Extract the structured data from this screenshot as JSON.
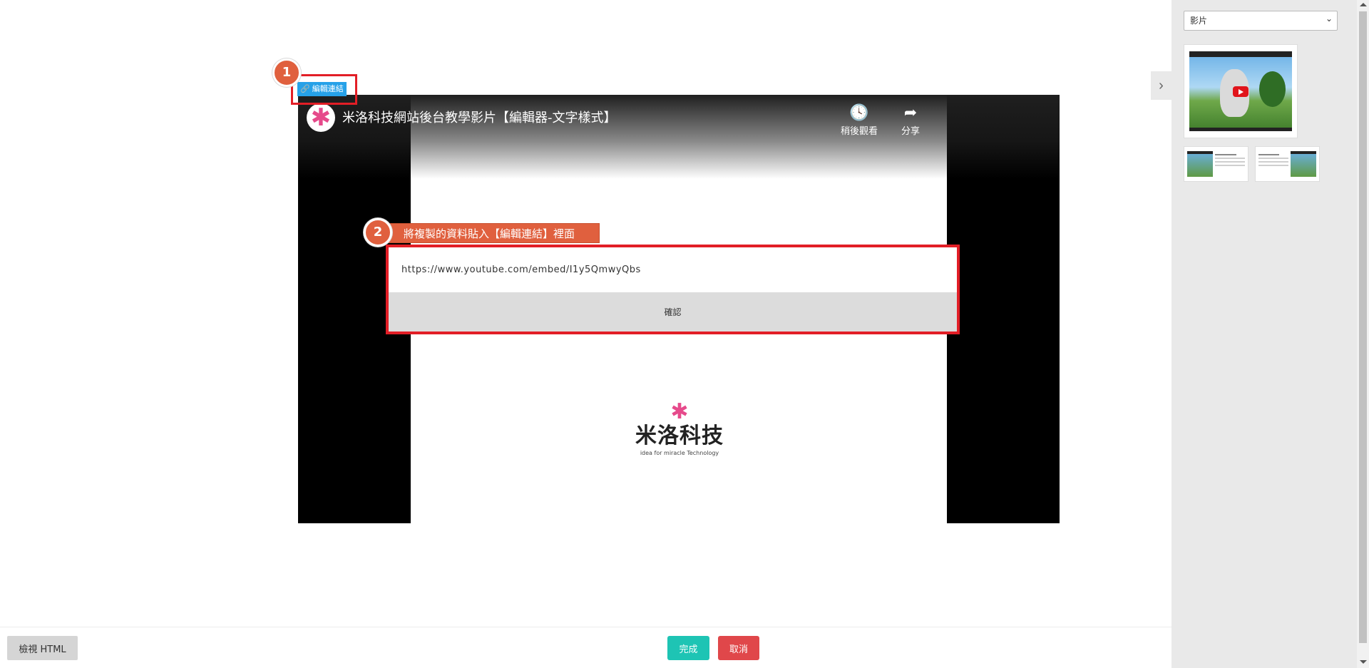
{
  "video": {
    "title": "米洛科技網站後台教學影片【編輯器-文字樣式】",
    "watch_later_label": "稍後觀看",
    "share_label": "分享",
    "brand_name": "米洛科技",
    "brand_tagline": "idea for miracle Technology"
  },
  "annotations": {
    "step1_number": "1",
    "step2_number": "2",
    "step2_text": "將複製的資料貼入【編輯連結】裡面"
  },
  "editor": {
    "edit_link_label": "編輯連結",
    "url_value": "https://www.youtube.com/embed/I1y5QmwyQbs",
    "confirm_label": "確認"
  },
  "footer": {
    "view_html_label": "檢視 HTML",
    "done_label": "完成",
    "cancel_label": "取消"
  },
  "sidebar": {
    "category_selected": "影片",
    "toggle_icon": "chevron-right-icon"
  },
  "colors": {
    "annotation_red": "#e21e26",
    "badge_orange": "#e0603e",
    "done_teal": "#1ec4b4",
    "cancel_red": "#e0474a",
    "link_blue": "#26a1e8",
    "brand_pink": "#e64a8b"
  }
}
